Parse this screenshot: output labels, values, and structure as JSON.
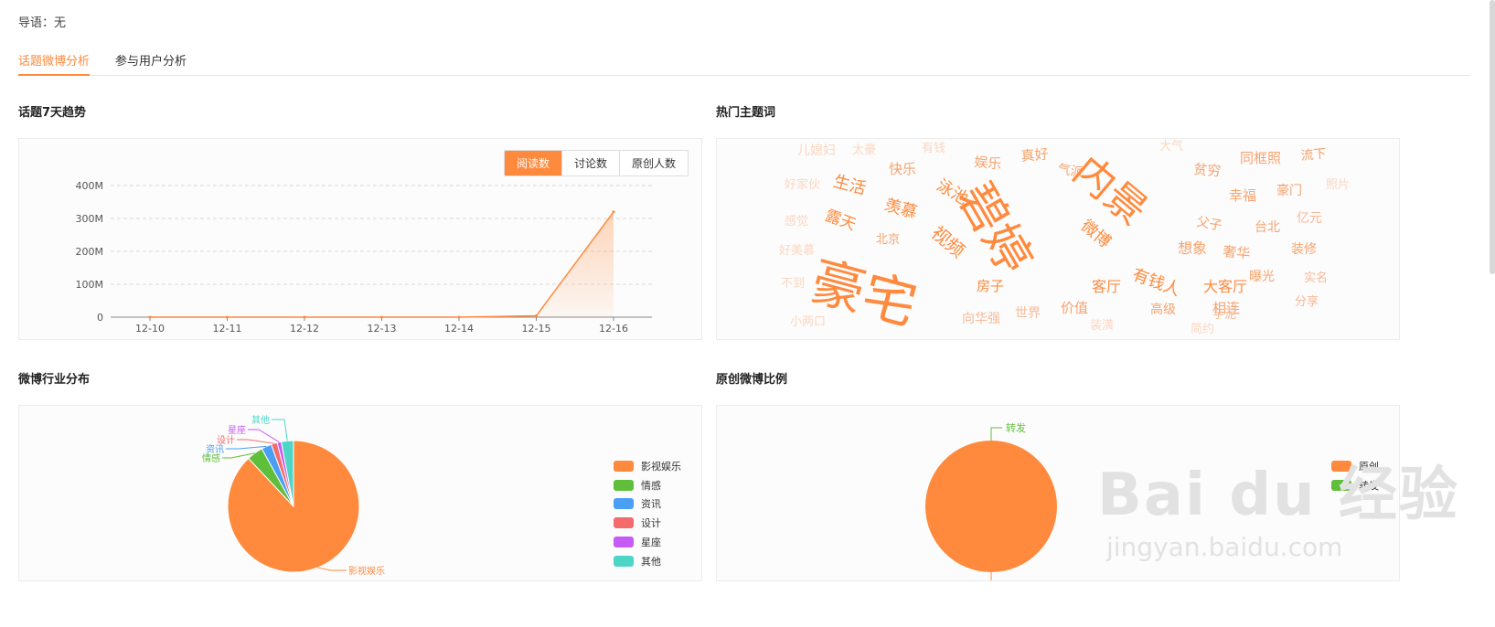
{
  "intro": "导语：无",
  "tabs": [
    {
      "label": "话题微博分析",
      "active": true
    },
    {
      "label": "参与用户分析",
      "active": false
    }
  ],
  "trend": {
    "title": "话题7天趋势",
    "buttons": [
      {
        "label": "阅读数",
        "active": true
      },
      {
        "label": "讨论数",
        "active": false
      },
      {
        "label": "原创人数",
        "active": false
      }
    ]
  },
  "wordcloud": {
    "title": "热门主题词",
    "words": [
      "儿媳妇",
      "太豪",
      "有钱",
      "娱乐",
      "真好",
      "大气",
      "同框照",
      "流下",
      "好家伙",
      "生活",
      "快乐",
      "泳池",
      "气派",
      "贫穷",
      "幸福",
      "豪门",
      "照片",
      "感觉",
      "露天",
      "羡慕",
      "视频",
      "碧婷",
      "内景",
      "微博",
      "父子",
      "台北",
      "亿元",
      "好美慕",
      "北京",
      "想象",
      "奢华",
      "装修",
      "不到",
      "豪宅",
      "房子",
      "有钱人",
      "大客厅",
      "曝光",
      "实名",
      "小两口",
      "向华强",
      "世界",
      "价值",
      "客厅",
      "高级",
      "相连",
      "分享",
      "装潢",
      "简约",
      "芋泥"
    ]
  },
  "industry": {
    "title": "微博行业分布",
    "slice_labels": [
      "其他",
      "星座",
      "设计",
      "资讯",
      "情感",
      "影视娱乐"
    ]
  },
  "original": {
    "title": "原创微博比例",
    "slice_labels": [
      "转发",
      "原创"
    ]
  },
  "watermark": {
    "line1": "Bai du 经验",
    "line2": "jingyan.baidu.com"
  },
  "chart_data": [
    {
      "type": "area",
      "x": [
        "12-10",
        "12-11",
        "12-12",
        "12-13",
        "12-14",
        "12-15",
        "12-16"
      ],
      "values": [
        0,
        0,
        0,
        0,
        0,
        4,
        320
      ],
      "ylim": [
        0,
        400
      ],
      "yticks": [
        "0",
        "100M",
        "200M",
        "300M",
        "400M"
      ],
      "ytick_values": [
        0,
        100,
        200,
        300,
        400
      ],
      "grid": true,
      "color": "#ff8a3d"
    },
    {
      "type": "pie",
      "labels": [
        "影视娱乐",
        "情感",
        "资讯",
        "设计",
        "星座",
        "其他"
      ],
      "values": [
        88,
        4,
        2.5,
        1.5,
        1,
        3
      ],
      "colors": [
        "#ff8a3d",
        "#5fbe3a",
        "#4a9ff5",
        "#f36b6b",
        "#c65cf5",
        "#4dd6c6"
      ],
      "legend": "right"
    },
    {
      "type": "pie",
      "labels": [
        "原创",
        "转发"
      ],
      "values": [
        100,
        0
      ],
      "colors": [
        "#ff8a3d",
        "#5fbe3a"
      ],
      "legend": "right"
    }
  ]
}
